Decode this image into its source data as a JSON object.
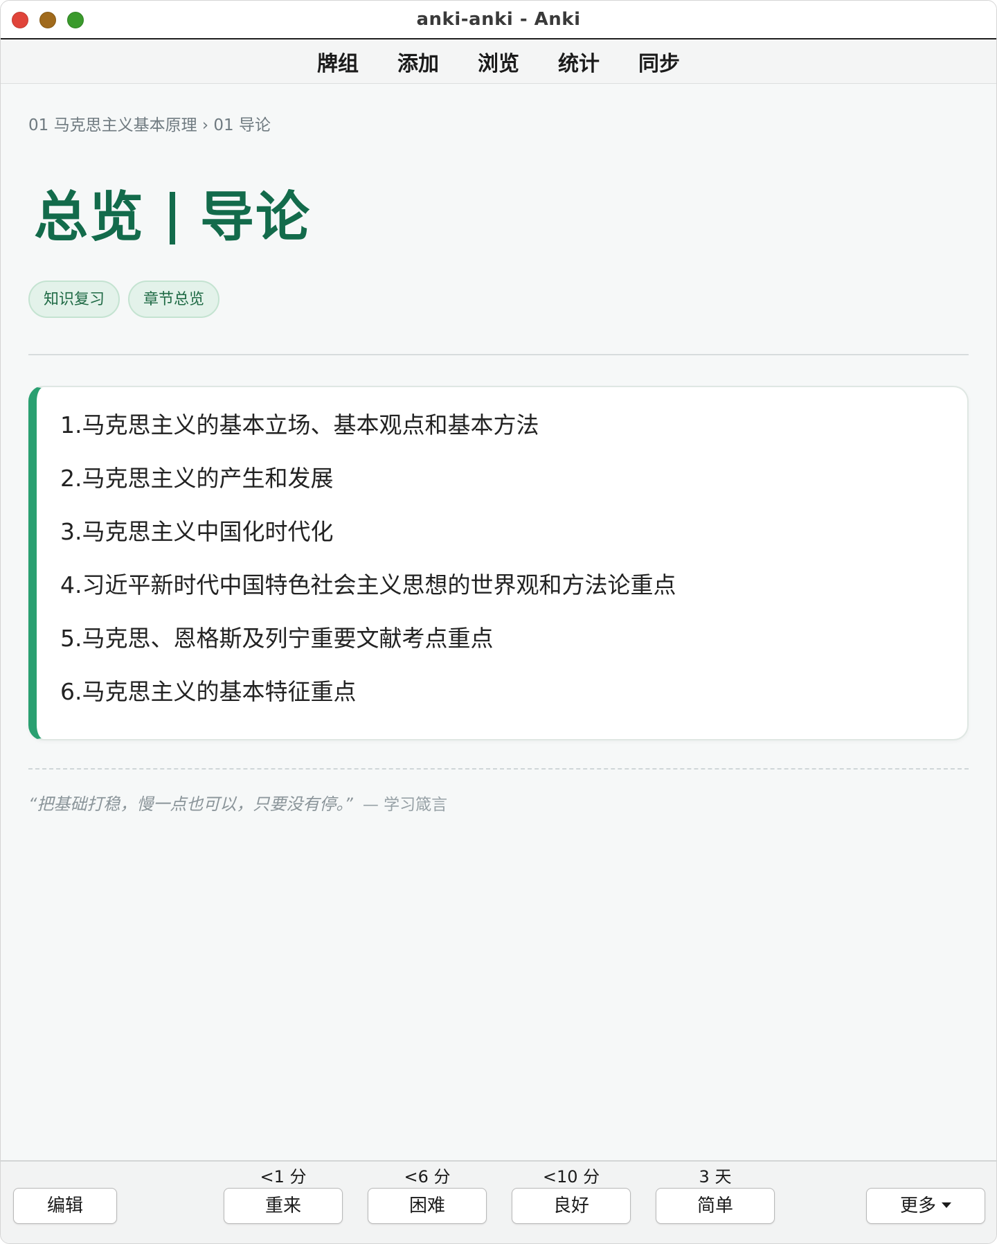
{
  "window": {
    "title": "anki-anki - Anki"
  },
  "nav": {
    "items": [
      {
        "label": "牌组"
      },
      {
        "label": "添加"
      },
      {
        "label": "浏览"
      },
      {
        "label": "统计"
      },
      {
        "label": "同步"
      }
    ]
  },
  "card": {
    "breadcrumb": "01 马克思主义基本原理 › 01 导论",
    "title_left": "总览",
    "title_right": "导论",
    "tags": [
      "知识复习",
      "章节总览"
    ],
    "items": [
      "1.马克思主义的基本立场、基本观点和基本方法",
      "2.马克思主义的产生和发展",
      "3.马克思主义中国化时代化",
      "4.习近平新时代中国特色社会主义思想的世界观和方法论重点",
      "5.马克思、恩格斯及列宁重要文献考点重点",
      "6.马克思主义的基本特征重点"
    ],
    "quote": "“把基础打稳，慢一点也可以，只要没有停。”",
    "quote_source": "— 学习箴言",
    "accent_color": "#2aa071",
    "title_color": "#136b4b"
  },
  "bottom": {
    "edit_label": "编辑",
    "more_label": "更多",
    "answers": [
      {
        "interval": "<1 分",
        "label": "重来"
      },
      {
        "interval": "<6 分",
        "label": "困难"
      },
      {
        "interval": "<10 分",
        "label": "良好"
      },
      {
        "interval": "3 天",
        "label": "简单"
      }
    ]
  }
}
